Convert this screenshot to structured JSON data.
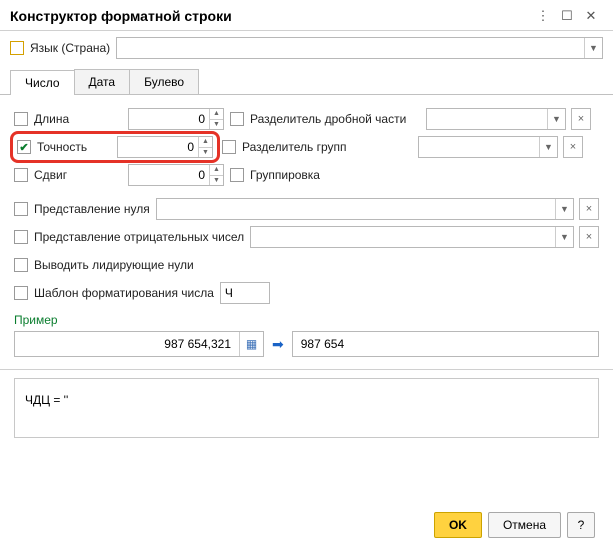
{
  "title": "Конструктор форматной строки",
  "lang": {
    "label": "Язык (Страна)"
  },
  "tabs": {
    "number": "Число",
    "date": "Дата",
    "bool": "Булево"
  },
  "fields": {
    "length": {
      "label": "Длина",
      "value": "0"
    },
    "precision": {
      "label": "Точность",
      "value": "0"
    },
    "shift": {
      "label": "Сдвиг",
      "value": "0"
    },
    "frac_sep": {
      "label": "Разделитель дробной части"
    },
    "grp_sep": {
      "label": "Разделитель групп"
    },
    "grouping": {
      "label": "Группировка"
    },
    "zero_rep": {
      "label": "Представление нуля"
    },
    "neg_rep": {
      "label": "Представление отрицательных чисел"
    },
    "lead_z": {
      "label": "Выводить лидирующие нули"
    },
    "num_tpl": {
      "label": "Шаблон форматирования числа",
      "value": "Ч"
    }
  },
  "example": {
    "label": "Пример",
    "input": "987 654,321",
    "output": "987 654"
  },
  "result": "ЧДЦ = ''",
  "buttons": {
    "ok": "OK",
    "cancel": "Отмена",
    "help": "?"
  }
}
